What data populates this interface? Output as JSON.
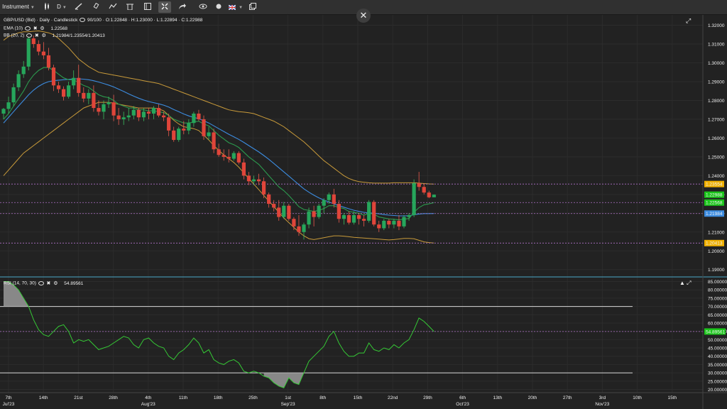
{
  "toolbar": {
    "instrument_label": "Instrument",
    "timeframe_label": "D",
    "flag_label": "UK"
  },
  "chart_info": {
    "title_line": "GBP/USD (Bid) · Daily · Candlestick",
    "zoom": "90/100",
    "ohlc": {
      "o": "O:1.22848",
      "h": "H:1.23000",
      "l": "L:1.22894",
      "c": "C:1.22988"
    },
    "ema_label": "EMA (10)",
    "ema_value": "1.22568",
    "bb_label": "BB (20, 2)",
    "bb_value": "1.21984/1.23554/1.20413",
    "rsi_label": "RSI (14, 70, 30)",
    "rsi_value": "54.89561"
  },
  "price_axis": {
    "ticks": [
      "1.32000",
      "1.31000",
      "1.30000",
      "1.29000",
      "1.28000",
      "1.27000",
      "1.26000",
      "1.25000",
      "1.24000",
      "1.23000",
      "1.22000",
      "1.21000",
      "1.20000",
      "1.19000"
    ],
    "markers": [
      {
        "label": "1.23554",
        "price": 1.23554,
        "color": "#f0b000"
      },
      {
        "label": "1.22988",
        "price": 1.22988,
        "color": "#1bc61b"
      },
      {
        "label": "1.22568",
        "price": 1.22568,
        "color": "#1bc61b"
      },
      {
        "label": "1.21984",
        "price": 1.21984,
        "color": "#3c8ce0"
      },
      {
        "label": "1.20413",
        "price": 1.20413,
        "color": "#f0b000"
      }
    ]
  },
  "rsi_axis": {
    "ticks": [
      "85.00000",
      "80.00000",
      "75.00000",
      "70.00000",
      "65.00000",
      "60.00000",
      "55.00000",
      "50.00000",
      "45.00000",
      "40.00000",
      "35.00000",
      "30.00000",
      "25.00000",
      "20.00000"
    ],
    "marker": {
      "label": "54.89561",
      "value": 54.89561,
      "color": "#1bc61b"
    }
  },
  "date_axis": [
    {
      "l1": "7th",
      "l2": "Jul'23"
    },
    {
      "l1": "14th",
      "l2": ""
    },
    {
      "l1": "21st",
      "l2": ""
    },
    {
      "l1": "28th",
      "l2": ""
    },
    {
      "l1": "4th",
      "l2": "Aug'23"
    },
    {
      "l1": "11th",
      "l2": ""
    },
    {
      "l1": "18th",
      "l2": ""
    },
    {
      "l1": "25th",
      "l2": ""
    },
    {
      "l1": "1st",
      "l2": "Sep'23"
    },
    {
      "l1": "8th",
      "l2": ""
    },
    {
      "l1": "15th",
      "l2": ""
    },
    {
      "l1": "22nd",
      "l2": ""
    },
    {
      "l1": "29th",
      "l2": ""
    },
    {
      "l1": "6th",
      "l2": "Oct'23"
    },
    {
      "l1": "13th",
      "l2": ""
    },
    {
      "l1": "20th",
      "l2": ""
    },
    {
      "l1": "27th",
      "l2": ""
    },
    {
      "l1": "3rd",
      "l2": "Nov'23"
    },
    {
      "l1": "10th",
      "l2": ""
    },
    {
      "l1": "15th",
      "l2": ""
    }
  ],
  "colors": {
    "up": "#26a65b",
    "down": "#e0453a",
    "ema": "#2c9a4e",
    "bb_mid": "#3c8ce0",
    "bb_band": "#c89a3a",
    "rsi": "#35c835",
    "grid": "#2c2c2c"
  },
  "chart_data": {
    "type": "candlestick",
    "symbol": "GBP/USD",
    "ylim": [
      1.19,
      1.325
    ],
    "candles": [
      {
        "o": 1.273,
        "h": 1.276,
        "l": 1.27,
        "c": 1.2755
      },
      {
        "o": 1.2755,
        "h": 1.282,
        "l": 1.273,
        "c": 1.279
      },
      {
        "o": 1.279,
        "h": 1.289,
        "l": 1.277,
        "c": 1.287
      },
      {
        "o": 1.287,
        "h": 1.296,
        "l": 1.285,
        "c": 1.294
      },
      {
        "o": 1.294,
        "h": 1.301,
        "l": 1.292,
        "c": 1.298
      },
      {
        "o": 1.298,
        "h": 1.314,
        "l": 1.296,
        "c": 1.313
      },
      {
        "o": 1.313,
        "h": 1.3145,
        "l": 1.308,
        "c": 1.31
      },
      {
        "o": 1.31,
        "h": 1.312,
        "l": 1.304,
        "c": 1.306
      },
      {
        "o": 1.306,
        "h": 1.311,
        "l": 1.302,
        "c": 1.304
      },
      {
        "o": 1.304,
        "h": 1.308,
        "l": 1.296,
        "c": 1.2975
      },
      {
        "o": 1.2975,
        "h": 1.299,
        "l": 1.285,
        "c": 1.288
      },
      {
        "o": 1.288,
        "h": 1.29,
        "l": 1.284,
        "c": 1.286
      },
      {
        "o": 1.286,
        "h": 1.2875,
        "l": 1.28,
        "c": 1.282
      },
      {
        "o": 1.282,
        "h": 1.29,
        "l": 1.281,
        "c": 1.288
      },
      {
        "o": 1.288,
        "h": 1.296,
        "l": 1.286,
        "c": 1.292
      },
      {
        "o": 1.292,
        "h": 1.299,
        "l": 1.282,
        "c": 1.284
      },
      {
        "o": 1.284,
        "h": 1.287,
        "l": 1.279,
        "c": 1.281
      },
      {
        "o": 1.281,
        "h": 1.286,
        "l": 1.278,
        "c": 1.284
      },
      {
        "o": 1.284,
        "h": 1.288,
        "l": 1.274,
        "c": 1.276
      },
      {
        "o": 1.276,
        "h": 1.28,
        "l": 1.272,
        "c": 1.274
      },
      {
        "o": 1.274,
        "h": 1.28,
        "l": 1.27,
        "c": 1.278
      },
      {
        "o": 1.278,
        "h": 1.282,
        "l": 1.276,
        "c": 1.279
      },
      {
        "o": 1.279,
        "h": 1.283,
        "l": 1.269,
        "c": 1.272
      },
      {
        "o": 1.272,
        "h": 1.276,
        "l": 1.267,
        "c": 1.27
      },
      {
        "o": 1.27,
        "h": 1.274,
        "l": 1.267,
        "c": 1.271
      },
      {
        "o": 1.271,
        "h": 1.276,
        "l": 1.269,
        "c": 1.272
      },
      {
        "o": 1.272,
        "h": 1.277,
        "l": 1.27,
        "c": 1.275
      },
      {
        "o": 1.275,
        "h": 1.276,
        "l": 1.269,
        "c": 1.271
      },
      {
        "o": 1.271,
        "h": 1.276,
        "l": 1.269,
        "c": 1.274
      },
      {
        "o": 1.274,
        "h": 1.276,
        "l": 1.27,
        "c": 1.273
      },
      {
        "o": 1.273,
        "h": 1.277,
        "l": 1.27,
        "c": 1.276
      },
      {
        "o": 1.276,
        "h": 1.278,
        "l": 1.271,
        "c": 1.272
      },
      {
        "o": 1.272,
        "h": 1.274,
        "l": 1.269,
        "c": 1.271
      },
      {
        "o": 1.271,
        "h": 1.273,
        "l": 1.261,
        "c": 1.264
      },
      {
        "o": 1.264,
        "h": 1.266,
        "l": 1.258,
        "c": 1.259
      },
      {
        "o": 1.259,
        "h": 1.266,
        "l": 1.258,
        "c": 1.265
      },
      {
        "o": 1.265,
        "h": 1.269,
        "l": 1.262,
        "c": 1.264
      },
      {
        "o": 1.264,
        "h": 1.27,
        "l": 1.262,
        "c": 1.268
      },
      {
        "o": 1.268,
        "h": 1.274,
        "l": 1.266,
        "c": 1.273
      },
      {
        "o": 1.273,
        "h": 1.275,
        "l": 1.269,
        "c": 1.27
      },
      {
        "o": 1.27,
        "h": 1.272,
        "l": 1.259,
        "c": 1.261
      },
      {
        "o": 1.261,
        "h": 1.266,
        "l": 1.259,
        "c": 1.263
      },
      {
        "o": 1.263,
        "h": 1.265,
        "l": 1.252,
        "c": 1.254
      },
      {
        "o": 1.254,
        "h": 1.257,
        "l": 1.25,
        "c": 1.251
      },
      {
        "o": 1.251,
        "h": 1.254,
        "l": 1.248,
        "c": 1.25
      },
      {
        "o": 1.25,
        "h": 1.254,
        "l": 1.247,
        "c": 1.249
      },
      {
        "o": 1.249,
        "h": 1.253,
        "l": 1.248,
        "c": 1.252
      },
      {
        "o": 1.252,
        "h": 1.253,
        "l": 1.246,
        "c": 1.247
      },
      {
        "o": 1.247,
        "h": 1.249,
        "l": 1.238,
        "c": 1.24
      },
      {
        "o": 1.24,
        "h": 1.242,
        "l": 1.235,
        "c": 1.237
      },
      {
        "o": 1.237,
        "h": 1.24,
        "l": 1.235,
        "c": 1.238
      },
      {
        "o": 1.238,
        "h": 1.241,
        "l": 1.235,
        "c": 1.237
      },
      {
        "o": 1.237,
        "h": 1.239,
        "l": 1.228,
        "c": 1.23
      },
      {
        "o": 1.23,
        "h": 1.231,
        "l": 1.223,
        "c": 1.225
      },
      {
        "o": 1.225,
        "h": 1.227,
        "l": 1.221,
        "c": 1.223
      },
      {
        "o": 1.223,
        "h": 1.227,
        "l": 1.216,
        "c": 1.218
      },
      {
        "o": 1.218,
        "h": 1.226,
        "l": 1.217,
        "c": 1.224
      },
      {
        "o": 1.224,
        "h": 1.225,
        "l": 1.216,
        "c": 1.217
      },
      {
        "o": 1.217,
        "h": 1.218,
        "l": 1.211,
        "c": 1.213
      },
      {
        "o": 1.213,
        "h": 1.219,
        "l": 1.208,
        "c": 1.21
      },
      {
        "o": 1.21,
        "h": 1.215,
        "l": 1.206,
        "c": 1.214
      },
      {
        "o": 1.214,
        "h": 1.223,
        "l": 1.212,
        "c": 1.221
      },
      {
        "o": 1.221,
        "h": 1.224,
        "l": 1.213,
        "c": 1.218
      },
      {
        "o": 1.218,
        "h": 1.225,
        "l": 1.217,
        "c": 1.224
      },
      {
        "o": 1.224,
        "h": 1.228,
        "l": 1.22,
        "c": 1.227
      },
      {
        "o": 1.227,
        "h": 1.231,
        "l": 1.225,
        "c": 1.23
      },
      {
        "o": 1.23,
        "h": 1.233,
        "l": 1.223,
        "c": 1.225
      },
      {
        "o": 1.225,
        "h": 1.227,
        "l": 1.215,
        "c": 1.217
      },
      {
        "o": 1.217,
        "h": 1.22,
        "l": 1.214,
        "c": 1.219
      },
      {
        "o": 1.219,
        "h": 1.221,
        "l": 1.214,
        "c": 1.215
      },
      {
        "o": 1.215,
        "h": 1.221,
        "l": 1.214,
        "c": 1.219
      },
      {
        "o": 1.219,
        "h": 1.22,
        "l": 1.214,
        "c": 1.217
      },
      {
        "o": 1.217,
        "h": 1.219,
        "l": 1.213,
        "c": 1.216
      },
      {
        "o": 1.216,
        "h": 1.227,
        "l": 1.215,
        "c": 1.226
      },
      {
        "o": 1.226,
        "h": 1.227,
        "l": 1.213,
        "c": 1.214
      },
      {
        "o": 1.214,
        "h": 1.216,
        "l": 1.21,
        "c": 1.212
      },
      {
        "o": 1.212,
        "h": 1.217,
        "l": 1.211,
        "c": 1.216
      },
      {
        "o": 1.216,
        "h": 1.217,
        "l": 1.212,
        "c": 1.214
      },
      {
        "o": 1.214,
        "h": 1.217,
        "l": 1.212,
        "c": 1.216
      },
      {
        "o": 1.216,
        "h": 1.219,
        "l": 1.211,
        "c": 1.213
      },
      {
        "o": 1.213,
        "h": 1.219,
        "l": 1.212,
        "c": 1.218
      },
      {
        "o": 1.218,
        "h": 1.22,
        "l": 1.216,
        "c": 1.219
      },
      {
        "o": 1.219,
        "h": 1.238,
        "l": 1.218,
        "c": 1.236
      },
      {
        "o": 1.236,
        "h": 1.242,
        "l": 1.232,
        "c": 1.234
      },
      {
        "o": 1.234,
        "h": 1.236,
        "l": 1.23,
        "c": 1.231
      },
      {
        "o": 1.231,
        "h": 1.232,
        "l": 1.228,
        "c": 1.2285
      },
      {
        "o": 1.22848,
        "h": 1.23,
        "l": 1.22894,
        "c": 1.22988
      }
    ],
    "ema": [
      1.27,
      1.273,
      1.277,
      1.281,
      1.285,
      1.29,
      1.2935,
      1.296,
      1.2975,
      1.2975,
      1.296,
      1.294,
      1.292,
      1.291,
      1.291,
      1.2895,
      1.288,
      1.287,
      1.285,
      1.283,
      1.282,
      1.2815,
      1.28,
      1.278,
      1.277,
      1.276,
      1.276,
      1.275,
      1.275,
      1.2745,
      1.2745,
      1.274,
      1.2735,
      1.272,
      1.27,
      1.269,
      1.268,
      1.268,
      1.2685,
      1.269,
      1.2675,
      1.2665,
      1.264,
      1.2615,
      1.2595,
      1.2575,
      1.2565,
      1.255,
      1.2525,
      1.25,
      1.248,
      1.246,
      1.243,
      1.24,
      1.237,
      1.234,
      1.232,
      1.2295,
      1.2265,
      1.2235,
      1.222,
      1.2215,
      1.221,
      1.2215,
      1.2225,
      1.224,
      1.224,
      1.223,
      1.2225,
      1.221,
      1.2205,
      1.22,
      1.219,
      1.22,
      1.2195,
      1.218,
      1.2175,
      1.217,
      1.2168,
      1.2165,
      1.2168,
      1.2172,
      1.2205,
      1.223,
      1.2245,
      1.225,
      1.22568
    ],
    "bb_mid": [
      1.268,
      1.271,
      1.274,
      1.277,
      1.28,
      1.283,
      1.2855,
      1.2875,
      1.289,
      1.29,
      1.2905,
      1.2908,
      1.291,
      1.2912,
      1.2915,
      1.2915,
      1.2913,
      1.291,
      1.2905,
      1.2898,
      1.289,
      1.2882,
      1.2872,
      1.286,
      1.2848,
      1.2835,
      1.2823,
      1.2812,
      1.2802,
      1.2794,
      1.2788,
      1.2782,
      1.2775,
      1.2765,
      1.2752,
      1.274,
      1.2728,
      1.2718,
      1.271,
      1.2703,
      1.2692,
      1.268,
      1.2665,
      1.265,
      1.2635,
      1.262,
      1.2607,
      1.2593,
      1.2577,
      1.256,
      1.2543,
      1.2526,
      1.2507,
      1.2487,
      1.2465,
      1.2442,
      1.242,
      1.2398,
      1.2375,
      1.2352,
      1.233,
      1.2312,
      1.2296,
      1.2282,
      1.227,
      1.226,
      1.225,
      1.224,
      1.2232,
      1.2224,
      1.2216,
      1.221,
      1.2205,
      1.2202,
      1.22,
      1.2197,
      1.2193,
      1.219,
      1.2188,
      1.2186,
      1.2186,
      1.2187,
      1.2192,
      1.2196,
      1.2198,
      1.2198,
      1.21984
    ],
    "bb_upper": [
      1.312,
      1.314,
      1.315,
      1.316,
      1.3165,
      1.3165,
      1.3168,
      1.317,
      1.3165,
      1.316,
      1.315,
      1.313,
      1.3105,
      1.308,
      1.305,
      1.302,
      1.3,
      1.298,
      1.2965,
      1.295,
      1.2945,
      1.294,
      1.2935,
      1.293,
      1.2925,
      1.292,
      1.2915,
      1.291,
      1.2905,
      1.29,
      1.2895,
      1.289,
      1.288,
      1.287,
      1.286,
      1.285,
      1.284,
      1.283,
      1.282,
      1.281,
      1.28,
      1.279,
      1.278,
      1.277,
      1.276,
      1.275,
      1.2745,
      1.274,
      1.2738,
      1.2735,
      1.273,
      1.272,
      1.271,
      1.27,
      1.269,
      1.2675,
      1.266,
      1.264,
      1.262,
      1.26,
      1.258,
      1.2555,
      1.253,
      1.2505,
      1.248,
      1.246,
      1.244,
      1.242,
      1.24,
      1.2385,
      1.2375,
      1.2368,
      1.2365,
      1.2362,
      1.236,
      1.236,
      1.236,
      1.236,
      1.2362,
      1.2362,
      1.2362,
      1.2362,
      1.2362,
      1.236,
      1.2358,
      1.2356,
      1.23554
    ],
    "bb_lower": [
      1.24,
      1.243,
      1.246,
      1.249,
      1.252,
      1.254,
      1.256,
      1.258,
      1.26,
      1.262,
      1.264,
      1.266,
      1.268,
      1.27,
      1.272,
      1.274,
      1.276,
      1.277,
      1.278,
      1.279,
      1.279,
      1.279,
      1.2785,
      1.278,
      1.2775,
      1.277,
      1.2765,
      1.276,
      1.276,
      1.276,
      1.276,
      1.2755,
      1.2745,
      1.272,
      1.2695,
      1.2675,
      1.266,
      1.2655,
      1.265,
      1.264,
      1.2615,
      1.259,
      1.256,
      1.2535,
      1.251,
      1.249,
      1.247,
      1.2445,
      1.2415,
      1.2385,
      1.2355,
      1.2325,
      1.2295,
      1.2265,
      1.2235,
      1.2205,
      1.2175,
      1.215,
      1.2125,
      1.21,
      1.208,
      1.2065,
      1.206,
      1.2065,
      1.207,
      1.2075,
      1.208,
      1.208,
      1.2078,
      1.2075,
      1.2072,
      1.207,
      1.2068,
      1.2066,
      1.2064,
      1.2062,
      1.206,
      1.2058,
      1.206,
      1.2063,
      1.2066,
      1.2066,
      1.2064,
      1.2056,
      1.2048,
      1.2044,
      1.20413
    ],
    "rsi": [
      85,
      85,
      83,
      80,
      75,
      70,
      62,
      56,
      53,
      52,
      55,
      58,
      59,
      55,
      48,
      50,
      49,
      50,
      47,
      44,
      45,
      46,
      48,
      50,
      52,
      51,
      47,
      45,
      50,
      51,
      48,
      46,
      45,
      40,
      38,
      42,
      44,
      47,
      51,
      48,
      42,
      44,
      38,
      36,
      35,
      37,
      38,
      36,
      31,
      30,
      31,
      30,
      28,
      27,
      24,
      22,
      21,
      27,
      24,
      23,
      30,
      37,
      40,
      43,
      46,
      52,
      55,
      48,
      43,
      40,
      40,
      42,
      42,
      48,
      44,
      43,
      45,
      44,
      47,
      45,
      48,
      50,
      56,
      63,
      61,
      58,
      54.9
    ]
  }
}
